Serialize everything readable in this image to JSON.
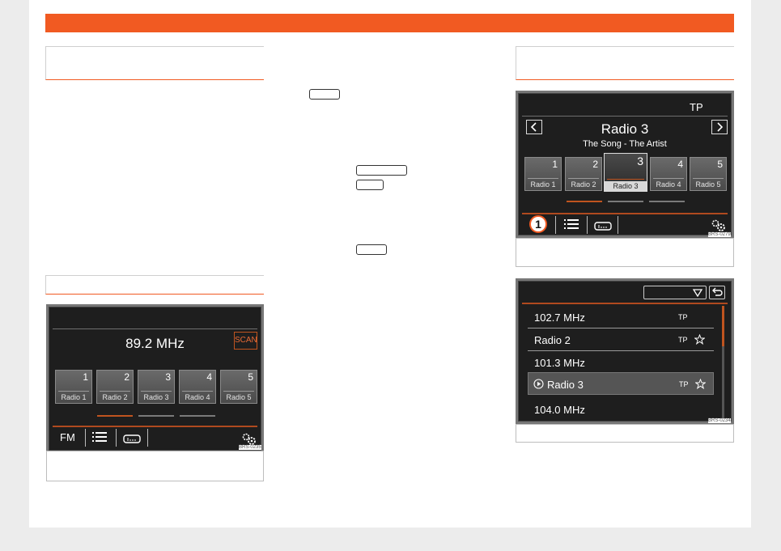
{
  "colors": {
    "accent": "#f15a22",
    "screen_bg": "#1e1e1e"
  },
  "screen_fm": {
    "frequency": "89.2 MHz",
    "scan_label": "SCAN",
    "presets": [
      {
        "num": "1",
        "label": "Radio 1"
      },
      {
        "num": "2",
        "label": "Radio 2"
      },
      {
        "num": "3",
        "label": "Radio 3"
      },
      {
        "num": "4",
        "label": "Radio 4"
      },
      {
        "num": "5",
        "label": "Radio 5"
      }
    ],
    "band_label": "FM",
    "code": "BRS-0235"
  },
  "screen_station": {
    "tp_label": "TP",
    "station_name": "Radio 3",
    "song": "The Song - The Artist",
    "presets": [
      {
        "num": "1",
        "label": "Radio 1"
      },
      {
        "num": "2",
        "label": "Radio 2"
      },
      {
        "num": "3",
        "label": "Radio 3"
      },
      {
        "num": "4",
        "label": "Radio 4"
      },
      {
        "num": "5",
        "label": "Radio 5"
      }
    ],
    "callout": "1",
    "code": "BRS-0279"
  },
  "screen_list": {
    "rows": [
      {
        "text": "102.7 MHz",
        "tp": "TP"
      },
      {
        "text": "Radio 2",
        "tp": "TP"
      },
      {
        "text": "101.3 MHz",
        "tp": ""
      },
      {
        "text": "Radio 3",
        "tp": "TP"
      },
      {
        "text": "104.0 MHz",
        "tp": ""
      }
    ],
    "code": "BRS-0234"
  }
}
